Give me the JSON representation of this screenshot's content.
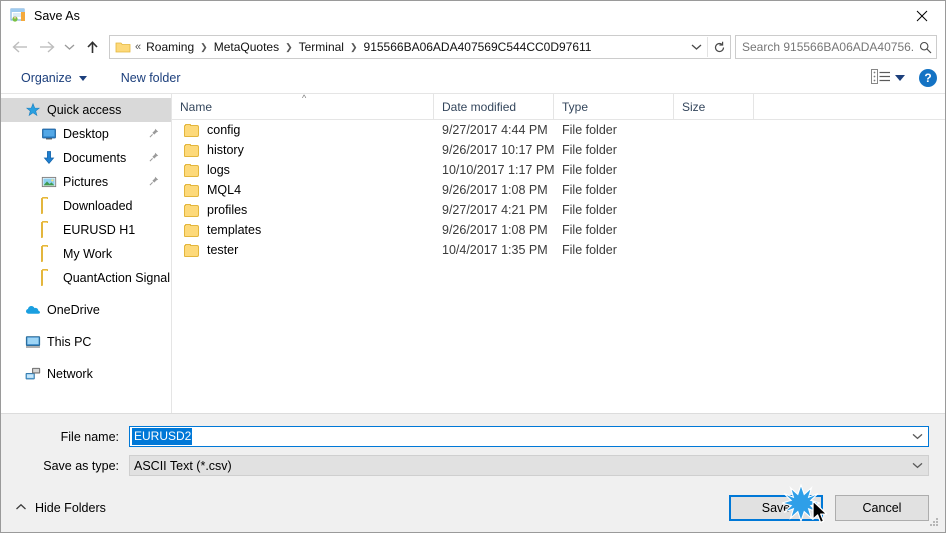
{
  "window": {
    "title": "Save As",
    "title_icon": "save-as-app-icon",
    "close_label": "✕"
  },
  "nav": {
    "back_icon": "back-arrow-icon",
    "forward_icon": "forward-arrow-icon",
    "recent_icon": "chevron-down-icon",
    "up_icon": "up-arrow-icon",
    "breadcrumb_prefix": "«",
    "breadcrumbs": [
      {
        "label": "Roaming"
      },
      {
        "label": "MetaQuotes"
      },
      {
        "label": "Terminal"
      },
      {
        "label": "915566BA06ADA407569C544CC0D97611"
      }
    ],
    "address_dropdown_icon": "chevron-down-icon",
    "refresh_icon": "refresh-icon"
  },
  "search": {
    "placeholder": "Search 915566BA06ADA40756...",
    "icon": "search-icon"
  },
  "toolbar": {
    "organize_label": "Organize",
    "new_folder_label": "New folder",
    "view_icon": "list-view-icon",
    "help_label": "?"
  },
  "sidebar": {
    "items": [
      {
        "label": "Quick access",
        "icon": "star-icon",
        "indent": 0,
        "selected": true,
        "pinned": false
      },
      {
        "label": "Desktop",
        "icon": "desktop-icon",
        "indent": 1,
        "selected": false,
        "pinned": true
      },
      {
        "label": "Documents",
        "icon": "documents-icon",
        "indent": 1,
        "selected": false,
        "pinned": true
      },
      {
        "label": "Pictures",
        "icon": "pictures-icon",
        "indent": 1,
        "selected": false,
        "pinned": true
      },
      {
        "label": "Downloaded",
        "icon": "folder-icon",
        "indent": 1,
        "selected": false,
        "pinned": false
      },
      {
        "label": "EURUSD H1",
        "icon": "folder-icon",
        "indent": 1,
        "selected": false,
        "pinned": false
      },
      {
        "label": "My Work",
        "icon": "folder-icon",
        "indent": 1,
        "selected": false,
        "pinned": false
      },
      {
        "label": "QuantAction Signal",
        "icon": "folder-icon",
        "indent": 1,
        "selected": false,
        "pinned": false
      },
      {
        "label": "OneDrive",
        "icon": "onedrive-icon",
        "indent": 0,
        "selected": false,
        "pinned": false,
        "gap_before": true
      },
      {
        "label": "This PC",
        "icon": "this-pc-icon",
        "indent": 0,
        "selected": false,
        "pinned": false,
        "gap_before": true
      },
      {
        "label": "Network",
        "icon": "network-icon",
        "indent": 0,
        "selected": false,
        "pinned": false,
        "gap_before": true
      }
    ]
  },
  "filelist": {
    "columns": [
      "Name",
      "Date modified",
      "Type",
      "Size"
    ],
    "sort_indicator": "^",
    "rows": [
      {
        "name": "config",
        "date": "9/27/2017 4:44 PM",
        "type": "File folder",
        "size": ""
      },
      {
        "name": "history",
        "date": "9/26/2017 10:17 PM",
        "type": "File folder",
        "size": ""
      },
      {
        "name": "logs",
        "date": "10/10/2017 1:17 PM",
        "type": "File folder",
        "size": ""
      },
      {
        "name": "MQL4",
        "date": "9/26/2017 1:08 PM",
        "type": "File folder",
        "size": ""
      },
      {
        "name": "profiles",
        "date": "9/27/2017 4:21 PM",
        "type": "File folder",
        "size": ""
      },
      {
        "name": "templates",
        "date": "9/26/2017 1:08 PM",
        "type": "File folder",
        "size": ""
      },
      {
        "name": "tester",
        "date": "10/4/2017 1:35 PM",
        "type": "File folder",
        "size": ""
      }
    ]
  },
  "form": {
    "filename_label": "File name:",
    "filename_value": "EURUSD2",
    "filetype_label": "Save as type:",
    "filetype_value": "ASCII Text (*.csv)",
    "dropdown_icon": "chevron-down-icon"
  },
  "footer": {
    "hide_folders_label": "Hide Folders",
    "hide_folders_caret": "^",
    "save_label": "Save",
    "cancel_label": "Cancel"
  },
  "colors": {
    "accent": "#0078d7",
    "selection": "#0078d7",
    "folder": "#fdd97a",
    "help": "#1473c4",
    "sidebar_selected": "#d9d9d9"
  }
}
